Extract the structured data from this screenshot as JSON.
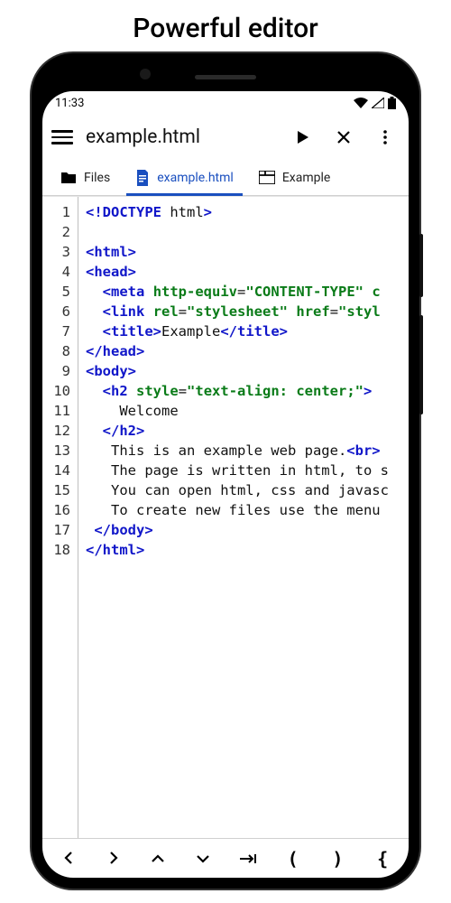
{
  "page_title": "Powerful editor",
  "status": {
    "time": "11:33"
  },
  "appbar": {
    "title": "example.html"
  },
  "tabs": [
    {
      "label": "Files",
      "icon": "folder",
      "active": false
    },
    {
      "label": "example.html",
      "icon": "file",
      "active": true
    },
    {
      "label": "Example",
      "icon": "browser",
      "active": false
    }
  ],
  "gutter_lines": [
    "1",
    "2",
    "3",
    "4",
    "5",
    "6",
    "7",
    "8",
    "9",
    "10",
    "11",
    "12",
    "13",
    "14",
    "15",
    "16",
    "17",
    "18"
  ],
  "code_tokens": [
    [
      {
        "t": "tag",
        "v": "<!DOCTYPE"
      },
      {
        "t": "text",
        "v": " html"
      },
      {
        "t": "tag",
        "v": ">"
      }
    ],
    [],
    [
      {
        "t": "tag",
        "v": "<html>"
      }
    ],
    [
      {
        "t": "tag",
        "v": "<head>"
      }
    ],
    [
      {
        "t": "text",
        "v": "  "
      },
      {
        "t": "tag",
        "v": "<meta"
      },
      {
        "t": "text",
        "v": " "
      },
      {
        "t": "attr",
        "v": "http-equiv"
      },
      {
        "t": "text",
        "v": "="
      },
      {
        "t": "str",
        "v": "\"CONTENT-TYPE\""
      },
      {
        "t": "text",
        "v": " "
      },
      {
        "t": "attr",
        "v": "c"
      }
    ],
    [
      {
        "t": "text",
        "v": "  "
      },
      {
        "t": "tag",
        "v": "<link"
      },
      {
        "t": "text",
        "v": " "
      },
      {
        "t": "attr",
        "v": "rel"
      },
      {
        "t": "text",
        "v": "="
      },
      {
        "t": "str",
        "v": "\"stylesheet\""
      },
      {
        "t": "text",
        "v": " "
      },
      {
        "t": "attr",
        "v": "href"
      },
      {
        "t": "text",
        "v": "="
      },
      {
        "t": "str",
        "v": "\"styl"
      }
    ],
    [
      {
        "t": "text",
        "v": "  "
      },
      {
        "t": "tag",
        "v": "<title>"
      },
      {
        "t": "text",
        "v": "Example"
      },
      {
        "t": "tag",
        "v": "</title>"
      }
    ],
    [
      {
        "t": "tag",
        "v": "</head>"
      }
    ],
    [
      {
        "t": "tag",
        "v": "<body>"
      }
    ],
    [
      {
        "t": "text",
        "v": "  "
      },
      {
        "t": "tag",
        "v": "<h2"
      },
      {
        "t": "text",
        "v": " "
      },
      {
        "t": "attr",
        "v": "style"
      },
      {
        "t": "text",
        "v": "="
      },
      {
        "t": "str",
        "v": "\"text-align: center;\""
      },
      {
        "t": "tag",
        "v": ">"
      }
    ],
    [
      {
        "t": "text",
        "v": "    Welcome"
      }
    ],
    [
      {
        "t": "text",
        "v": "  "
      },
      {
        "t": "tag",
        "v": "</h2>"
      }
    ],
    [
      {
        "t": "text",
        "v": "   This is an example web page."
      },
      {
        "t": "tag",
        "v": "<br>"
      }
    ],
    [
      {
        "t": "text",
        "v": "   The page is written in html, to s"
      }
    ],
    [
      {
        "t": "text",
        "v": "   You can open html, css and javasc"
      }
    ],
    [
      {
        "t": "text",
        "v": "   To create new files use the menu "
      }
    ],
    [
      {
        "t": "text",
        "v": " "
      },
      {
        "t": "tag",
        "v": "</body>"
      }
    ],
    [
      {
        "t": "tag",
        "v": "</html>"
      }
    ]
  ],
  "bottom_buttons": [
    "<",
    ">",
    "^",
    "v",
    "→|",
    "(",
    ")",
    "{"
  ]
}
